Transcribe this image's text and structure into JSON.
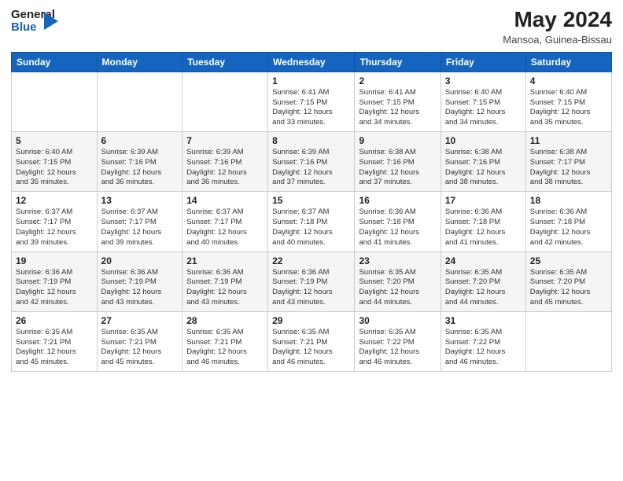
{
  "header": {
    "logo_general": "General",
    "logo_blue": "Blue",
    "month_title": "May 2024",
    "location": "Mansoa, Guinea-Bissau"
  },
  "days_of_week": [
    "Sunday",
    "Monday",
    "Tuesday",
    "Wednesday",
    "Thursday",
    "Friday",
    "Saturday"
  ],
  "weeks": [
    [
      {
        "day": "",
        "info": ""
      },
      {
        "day": "",
        "info": ""
      },
      {
        "day": "",
        "info": ""
      },
      {
        "day": "1",
        "info": "Sunrise: 6:41 AM\nSunset: 7:15 PM\nDaylight: 12 hours\nand 33 minutes."
      },
      {
        "day": "2",
        "info": "Sunrise: 6:41 AM\nSunset: 7:15 PM\nDaylight: 12 hours\nand 34 minutes."
      },
      {
        "day": "3",
        "info": "Sunrise: 6:40 AM\nSunset: 7:15 PM\nDaylight: 12 hours\nand 34 minutes."
      },
      {
        "day": "4",
        "info": "Sunrise: 6:40 AM\nSunset: 7:15 PM\nDaylight: 12 hours\nand 35 minutes."
      }
    ],
    [
      {
        "day": "5",
        "info": "Sunrise: 6:40 AM\nSunset: 7:15 PM\nDaylight: 12 hours\nand 35 minutes."
      },
      {
        "day": "6",
        "info": "Sunrise: 6:39 AM\nSunset: 7:16 PM\nDaylight: 12 hours\nand 36 minutes."
      },
      {
        "day": "7",
        "info": "Sunrise: 6:39 AM\nSunset: 7:16 PM\nDaylight: 12 hours\nand 36 minutes."
      },
      {
        "day": "8",
        "info": "Sunrise: 6:39 AM\nSunset: 7:16 PM\nDaylight: 12 hours\nand 37 minutes."
      },
      {
        "day": "9",
        "info": "Sunrise: 6:38 AM\nSunset: 7:16 PM\nDaylight: 12 hours\nand 37 minutes."
      },
      {
        "day": "10",
        "info": "Sunrise: 6:38 AM\nSunset: 7:16 PM\nDaylight: 12 hours\nand 38 minutes."
      },
      {
        "day": "11",
        "info": "Sunrise: 6:38 AM\nSunset: 7:17 PM\nDaylight: 12 hours\nand 38 minutes."
      }
    ],
    [
      {
        "day": "12",
        "info": "Sunrise: 6:37 AM\nSunset: 7:17 PM\nDaylight: 12 hours\nand 39 minutes."
      },
      {
        "day": "13",
        "info": "Sunrise: 6:37 AM\nSunset: 7:17 PM\nDaylight: 12 hours\nand 39 minutes."
      },
      {
        "day": "14",
        "info": "Sunrise: 6:37 AM\nSunset: 7:17 PM\nDaylight: 12 hours\nand 40 minutes."
      },
      {
        "day": "15",
        "info": "Sunrise: 6:37 AM\nSunset: 7:18 PM\nDaylight: 12 hours\nand 40 minutes."
      },
      {
        "day": "16",
        "info": "Sunrise: 6:36 AM\nSunset: 7:18 PM\nDaylight: 12 hours\nand 41 minutes."
      },
      {
        "day": "17",
        "info": "Sunrise: 6:36 AM\nSunset: 7:18 PM\nDaylight: 12 hours\nand 41 minutes."
      },
      {
        "day": "18",
        "info": "Sunrise: 6:36 AM\nSunset: 7:18 PM\nDaylight: 12 hours\nand 42 minutes."
      }
    ],
    [
      {
        "day": "19",
        "info": "Sunrise: 6:36 AM\nSunset: 7:19 PM\nDaylight: 12 hours\nand 42 minutes."
      },
      {
        "day": "20",
        "info": "Sunrise: 6:36 AM\nSunset: 7:19 PM\nDaylight: 12 hours\nand 43 minutes."
      },
      {
        "day": "21",
        "info": "Sunrise: 6:36 AM\nSunset: 7:19 PM\nDaylight: 12 hours\nand 43 minutes."
      },
      {
        "day": "22",
        "info": "Sunrise: 6:36 AM\nSunset: 7:19 PM\nDaylight: 12 hours\nand 43 minutes."
      },
      {
        "day": "23",
        "info": "Sunrise: 6:35 AM\nSunset: 7:20 PM\nDaylight: 12 hours\nand 44 minutes."
      },
      {
        "day": "24",
        "info": "Sunrise: 6:35 AM\nSunset: 7:20 PM\nDaylight: 12 hours\nand 44 minutes."
      },
      {
        "day": "25",
        "info": "Sunrise: 6:35 AM\nSunset: 7:20 PM\nDaylight: 12 hours\nand 45 minutes."
      }
    ],
    [
      {
        "day": "26",
        "info": "Sunrise: 6:35 AM\nSunset: 7:21 PM\nDaylight: 12 hours\nand 45 minutes."
      },
      {
        "day": "27",
        "info": "Sunrise: 6:35 AM\nSunset: 7:21 PM\nDaylight: 12 hours\nand 45 minutes."
      },
      {
        "day": "28",
        "info": "Sunrise: 6:35 AM\nSunset: 7:21 PM\nDaylight: 12 hours\nand 46 minutes."
      },
      {
        "day": "29",
        "info": "Sunrise: 6:35 AM\nSunset: 7:21 PM\nDaylight: 12 hours\nand 46 minutes."
      },
      {
        "day": "30",
        "info": "Sunrise: 6:35 AM\nSunset: 7:22 PM\nDaylight: 12 hours\nand 46 minutes."
      },
      {
        "day": "31",
        "info": "Sunrise: 6:35 AM\nSunset: 7:22 PM\nDaylight: 12 hours\nand 46 minutes."
      },
      {
        "day": "",
        "info": ""
      }
    ]
  ]
}
